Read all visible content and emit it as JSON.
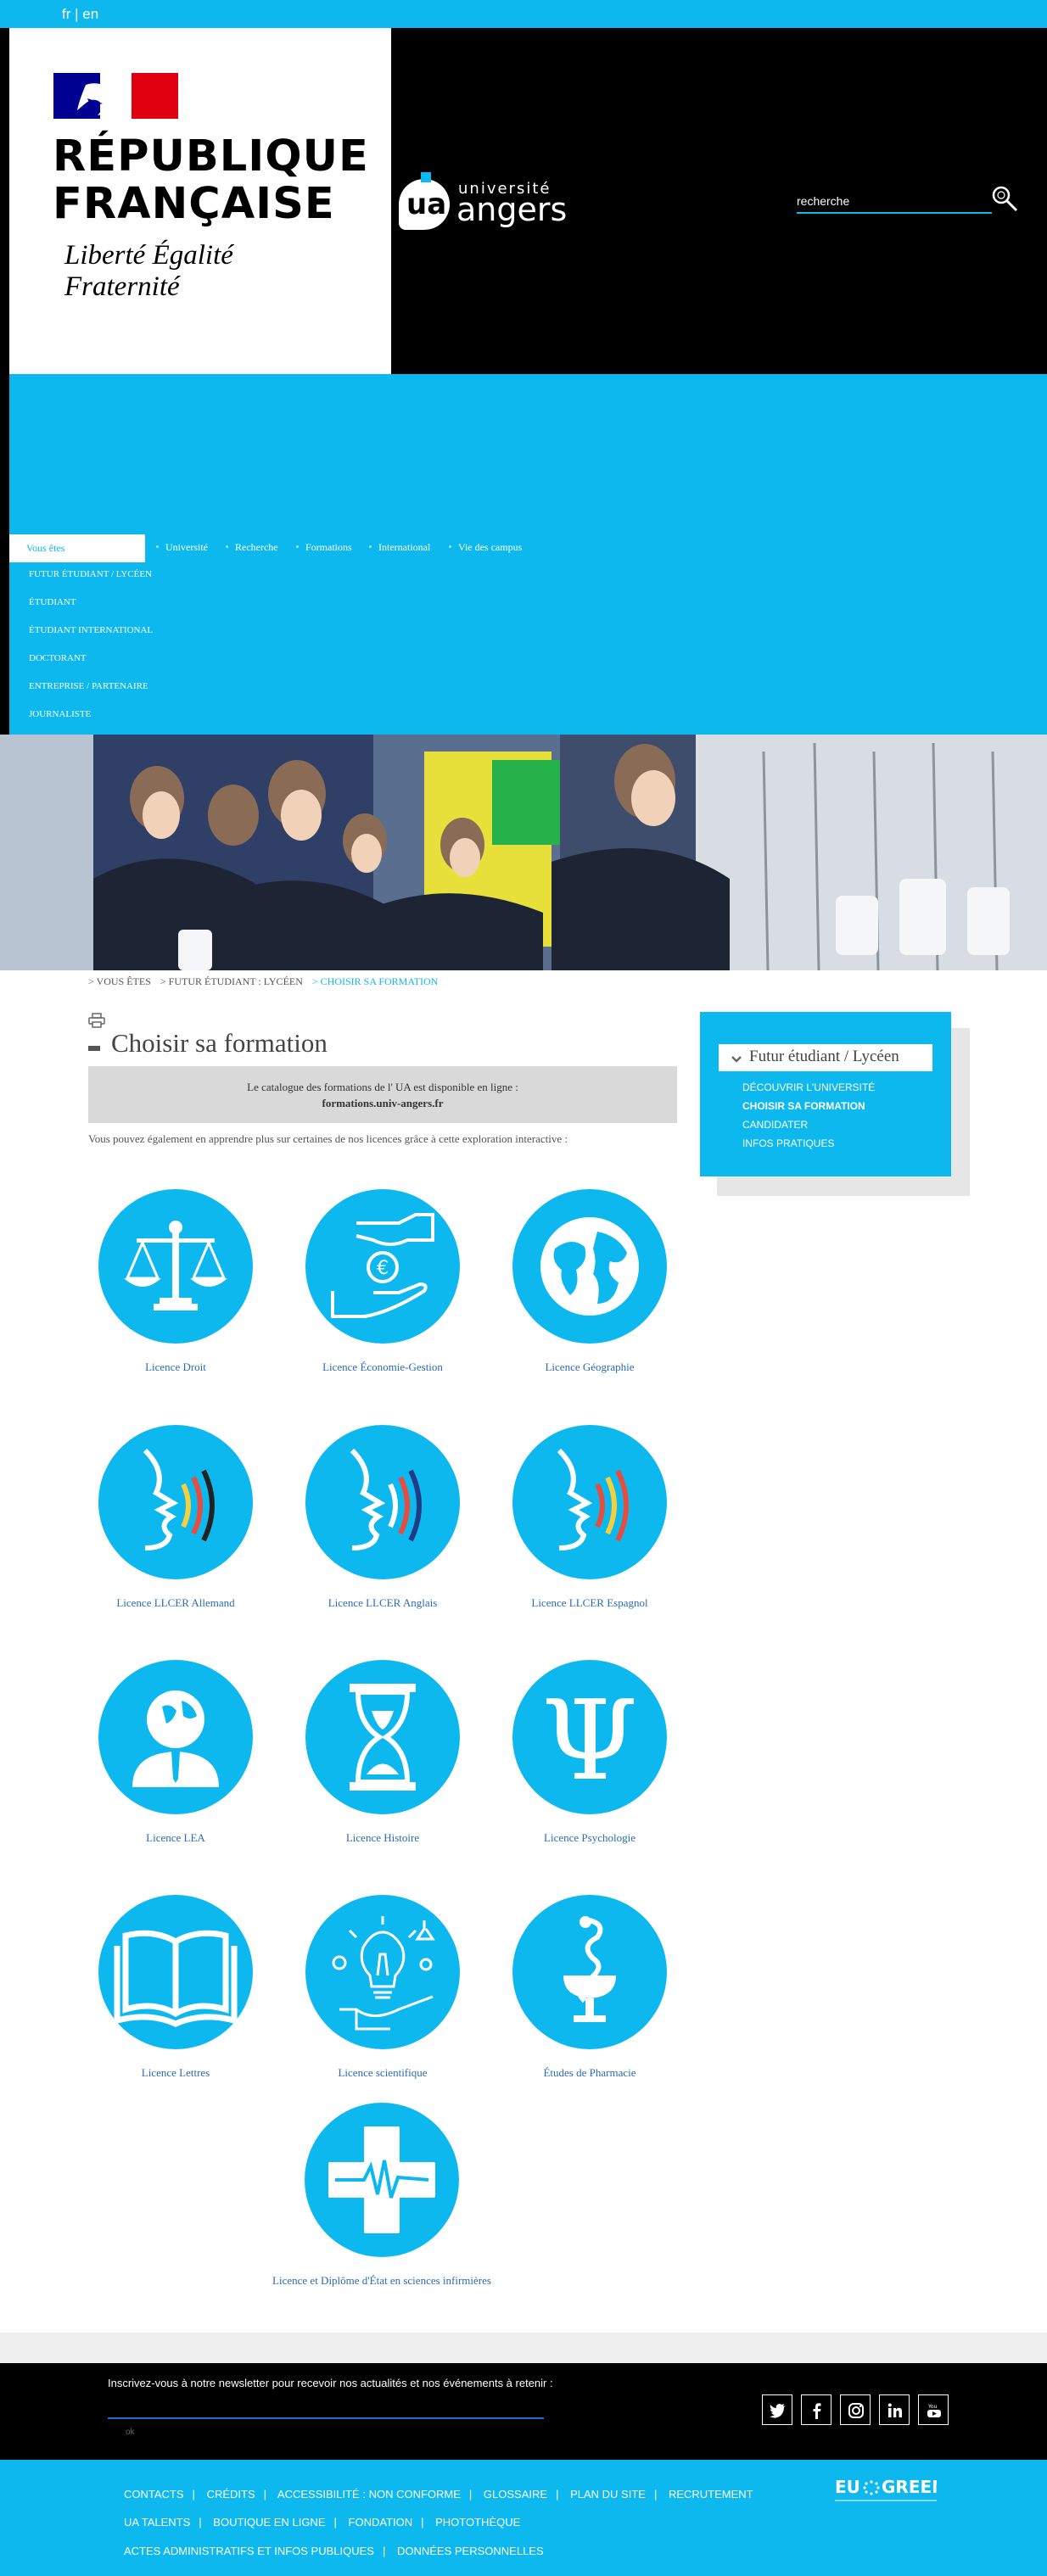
{
  "lang": {
    "text": "fr | en"
  },
  "republic": {
    "title": "RÉPUBLIQUE FRANÇAISE",
    "motto": "Liberté Égalité Fraternité"
  },
  "university": {
    "line1": "université",
    "line2": "angers",
    "mark": "ua"
  },
  "search": {
    "placeholder": "recherche"
  },
  "profiles": {
    "label": "Vous êtes",
    "items": [
      "FUTUR ÉTUDIANT / LYCÉEN",
      "ÉTUDIANT",
      "ÉTUDIANT INTERNATIONAL",
      "DOCTORANT",
      "ENTREPRISE / PARTENAIRE",
      "JOURNALISTE"
    ]
  },
  "main_nav": [
    "Université",
    "Recherche",
    "Formations",
    "International",
    "Vie des campus"
  ],
  "breadcrumb": {
    "home": "> VOUS ÊTES",
    "section": "> FUTUR ÉTUDIANT : LYCÉEN",
    "current": "> CHOISIR SA FORMATION"
  },
  "page": {
    "title": "Choisir sa formation",
    "catalog_text": "Le catalogue des formations de l' UA est disponible en ligne :",
    "catalog_link": "formations.univ-angers.fr",
    "intro": "Vous pouvez également en apprendre plus sur certaines de nos licences grâce à cette exploration interactive :"
  },
  "formations": [
    {
      "label": "Licence Droit",
      "icon": "scales-icon"
    },
    {
      "label": "Licence Économie-Gestion",
      "icon": "coin-hands-icon"
    },
    {
      "label": "Licence Géographie",
      "icon": "globe-icon"
    },
    {
      "label": "Licence LLCER Allemand",
      "icon": "speaking-face-icon"
    },
    {
      "label": "Licence LLCER Anglais",
      "icon": "speaking-face-icon"
    },
    {
      "label": "Licence LLCER Espagnol",
      "icon": "speaking-face-icon"
    },
    {
      "label": "Licence LEA",
      "icon": "globe-person-icon"
    },
    {
      "label": "Licence Histoire",
      "icon": "hourglass-icon"
    },
    {
      "label": "Licence Psychologie",
      "icon": "psi-icon"
    },
    {
      "label": "Licence Lettres",
      "icon": "open-book-icon"
    },
    {
      "label": "Licence scientifique",
      "icon": "lightbulb-science-icon"
    },
    {
      "label": "Études de Pharmacie",
      "icon": "caduceus-icon"
    },
    {
      "label": "Licence et Diplôme d'État en sciences infirmières",
      "icon": "medical-cross-icon"
    }
  ],
  "sidebar": {
    "title": "Futur étudiant / Lycéen",
    "items": [
      "DÉCOUVRIR L'UNIVERSITÉ",
      "CHOISIR SA FORMATION",
      "CANDIDATER",
      "INFOS PRATIQUES"
    ],
    "active_index": 1
  },
  "newsletter": {
    "text": "Inscrivez-vous à notre newsletter pour recevoir nos actualités et nos événements à retenir :",
    "ok": "ok"
  },
  "social": [
    "twitter-icon",
    "facebook-icon",
    "instagram-icon",
    "linkedin-icon",
    "youtube-icon"
  ],
  "footer": {
    "row1": [
      "CONTACTS",
      "CRÉDITS",
      "ACCESSIBILITÉ : NON CONFORME",
      "GLOSSAIRE",
      "PLAN DU SITE",
      "RECRUTEMENT"
    ],
    "row2": [
      "UA TALENTS",
      "BOUTIQUE EN LIGNE",
      "FONDATION",
      "PHOTOTHÈQUE"
    ],
    "row3": [
      "ACTES ADMINISTRATIFS ET INFOS PUBLIQUES",
      "DONNÉES PERSONNELLES"
    ],
    "eu_logo": "EU GREEN"
  },
  "colors": {
    "brand": "#0db8ef",
    "dark": "#000000",
    "link": "#2b6bb5"
  }
}
